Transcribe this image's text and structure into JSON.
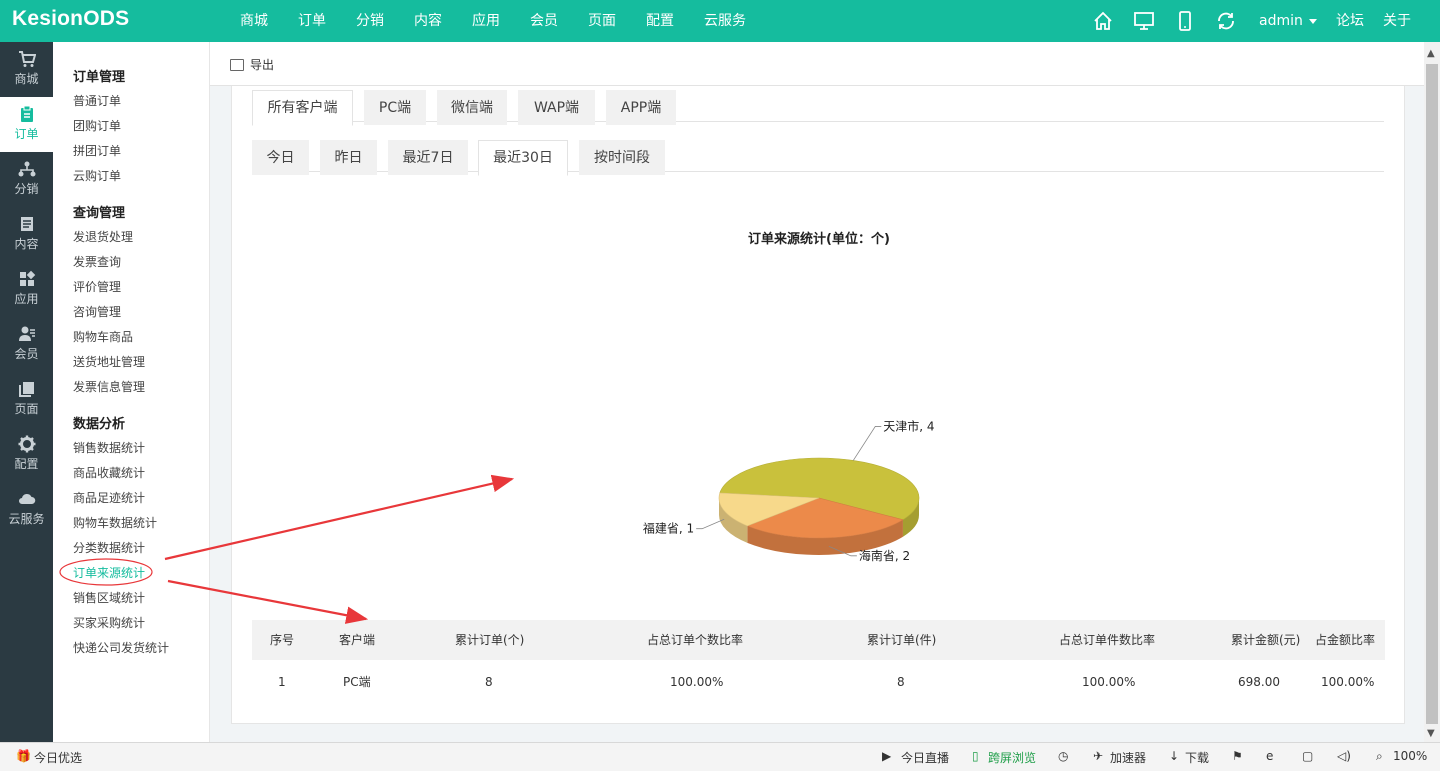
{
  "app": {
    "logo": "KesionODS"
  },
  "topnav": [
    "商城",
    "订单",
    "分销",
    "内容",
    "应用",
    "会员",
    "页面",
    "配置",
    "云服务"
  ],
  "topright": {
    "user": "admin",
    "forum": "论坛",
    "about": "关于"
  },
  "iconbar": [
    {
      "label": "商城",
      "icon": "cart-icon"
    },
    {
      "label": "订单",
      "icon": "clipboard-icon",
      "active": true
    },
    {
      "label": "分销",
      "icon": "network-icon"
    },
    {
      "label": "内容",
      "icon": "document-icon"
    },
    {
      "label": "应用",
      "icon": "apps-grid-icon"
    },
    {
      "label": "会员",
      "icon": "users-icon"
    },
    {
      "label": "页面",
      "icon": "pages-icon"
    },
    {
      "label": "配置",
      "icon": "gear-icon"
    },
    {
      "label": "云服务",
      "icon": "cloud-icon"
    }
  ],
  "submenu": {
    "group1": {
      "title": "订单管理",
      "items": [
        "普通订单",
        "团购订单",
        "拼团订单",
        "云购订单"
      ]
    },
    "group2": {
      "title": "查询管理",
      "items": [
        "发退货处理",
        "发票查询",
        "评价管理",
        "咨询管理",
        "购物车商品",
        "送货地址管理",
        "发票信息管理"
      ]
    },
    "group3": {
      "title": "数据分析",
      "items": [
        "销售数据统计",
        "商品收藏统计",
        "商品足迹统计",
        "购物车数据统计",
        "分类数据统计",
        "订单来源统计",
        "销售区域统计",
        "买家采购统计",
        "快递公司发货统计"
      ]
    }
  },
  "toolbar": {
    "export": "导出"
  },
  "client_tabs": [
    "所有客户端",
    "PC端",
    "微信端",
    "WAP端",
    "APP端"
  ],
  "period_tabs": [
    "今日",
    "昨日",
    "最近7日",
    "最近30日",
    "按时间段"
  ],
  "chart_data": {
    "type": "pie",
    "title": "订单来源统计(单位：个)",
    "slices": [
      {
        "label": "天津市",
        "value": 4,
        "color": "#c9c13c"
      },
      {
        "label": "海南省",
        "value": 2,
        "color": "#ec8a4a"
      },
      {
        "label": "福建省",
        "value": 1,
        "color": "#f7d98b"
      }
    ],
    "slice_labels": [
      "天津市, 4",
      "海南省, 2",
      "福建省, 1"
    ]
  },
  "table": {
    "headers": [
      "序号",
      "客户端",
      "累计订单(个)",
      "占总订单个数比率",
      "累计订单(件)",
      "占总订单件数比率",
      "累计金额(元)",
      "占金额比率"
    ],
    "rows": [
      [
        "1",
        "PC端",
        "8",
        "100.00%",
        "8",
        "100.00%",
        "698.00",
        "100.00%"
      ]
    ]
  },
  "statusbar": {
    "left": "今日优选",
    "live": "今日直播",
    "cross": "跨屏浏览",
    "accel": "加速器",
    "download": "下载",
    "zoom": "100%"
  },
  "colors": {
    "brand": "#15bc9e",
    "sidebar": "#2b3a42",
    "annotation": "#e8373a"
  }
}
